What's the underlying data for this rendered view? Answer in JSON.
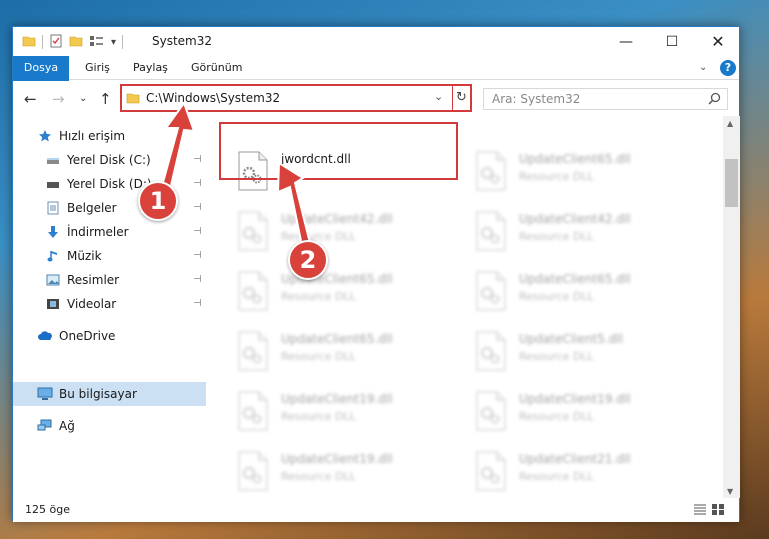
{
  "window": {
    "title": "System32",
    "min": "—",
    "max": "☐",
    "close": "✕"
  },
  "ribbon": {
    "tabs": [
      "Dosya",
      "Giriş",
      "Paylaş",
      "Görünüm"
    ],
    "chevron": "⌄",
    "help": "?"
  },
  "nav": {
    "back": "←",
    "forward": "→",
    "recent": "⌄",
    "up": "↑",
    "address": "C:\\Windows\\System32",
    "dropdown": "⌄",
    "refresh": "↻",
    "search_placeholder": "Ara: System32"
  },
  "sidebar": {
    "items": [
      {
        "label": "Hızlı erişim",
        "icon": "star-icon",
        "pinned": false
      },
      {
        "label": "Yerel Disk (C:)",
        "icon": "drive-icon",
        "pinned": true
      },
      {
        "label": "Yerel Disk (D:)",
        "icon": "drive-icon",
        "pinned": true
      },
      {
        "label": "Belgeler",
        "icon": "document-icon",
        "pinned": true
      },
      {
        "label": "İndirmeler",
        "icon": "download-icon",
        "pinned": true
      },
      {
        "label": "Müzik",
        "icon": "music-icon",
        "pinned": true
      },
      {
        "label": "Resimler",
        "icon": "picture-icon",
        "pinned": true
      },
      {
        "label": "Videolar",
        "icon": "video-icon",
        "pinned": true
      },
      {
        "label": "OneDrive",
        "icon": "cloud-icon",
        "pinned": false
      },
      {
        "label": "Bu bilgisayar",
        "icon": "computer-icon",
        "pinned": false,
        "selected": true
      },
      {
        "label": "Ağ",
        "icon": "network-icon",
        "pinned": false
      }
    ],
    "pin_glyph": "📌"
  },
  "files": [
    {
      "name": "jwordcnt.dll",
      "type": "",
      "highlighted": true
    },
    {
      "name": "UpdateClient65.dll",
      "type": "Resource DLL"
    },
    {
      "name": "UpdateClient42.dll",
      "type": "Resource DLL"
    },
    {
      "name": "UpdateClient42.dll",
      "type": "Resource DLL"
    },
    {
      "name": "UpdateClient65.dll",
      "type": "Resource DLL"
    },
    {
      "name": "UpdateClient65.dll",
      "type": "Resource DLL"
    },
    {
      "name": "UpdateClient65.dll",
      "type": "Resource DLL"
    },
    {
      "name": "UpdateClient5.dll",
      "type": "Resource DLL"
    },
    {
      "name": "UpdateClient19.dll",
      "type": "Resource DLL"
    },
    {
      "name": "UpdateClient19.dll",
      "type": "Resource DLL"
    },
    {
      "name": "UpdateClient19.dll",
      "type": "Resource DLL"
    },
    {
      "name": "UpdateClient21.dll",
      "type": "Resource DLL"
    }
  ],
  "status": {
    "count": "125 öge"
  },
  "annotations": {
    "step1": "1",
    "step2": "2",
    "color": "#d9413b"
  }
}
